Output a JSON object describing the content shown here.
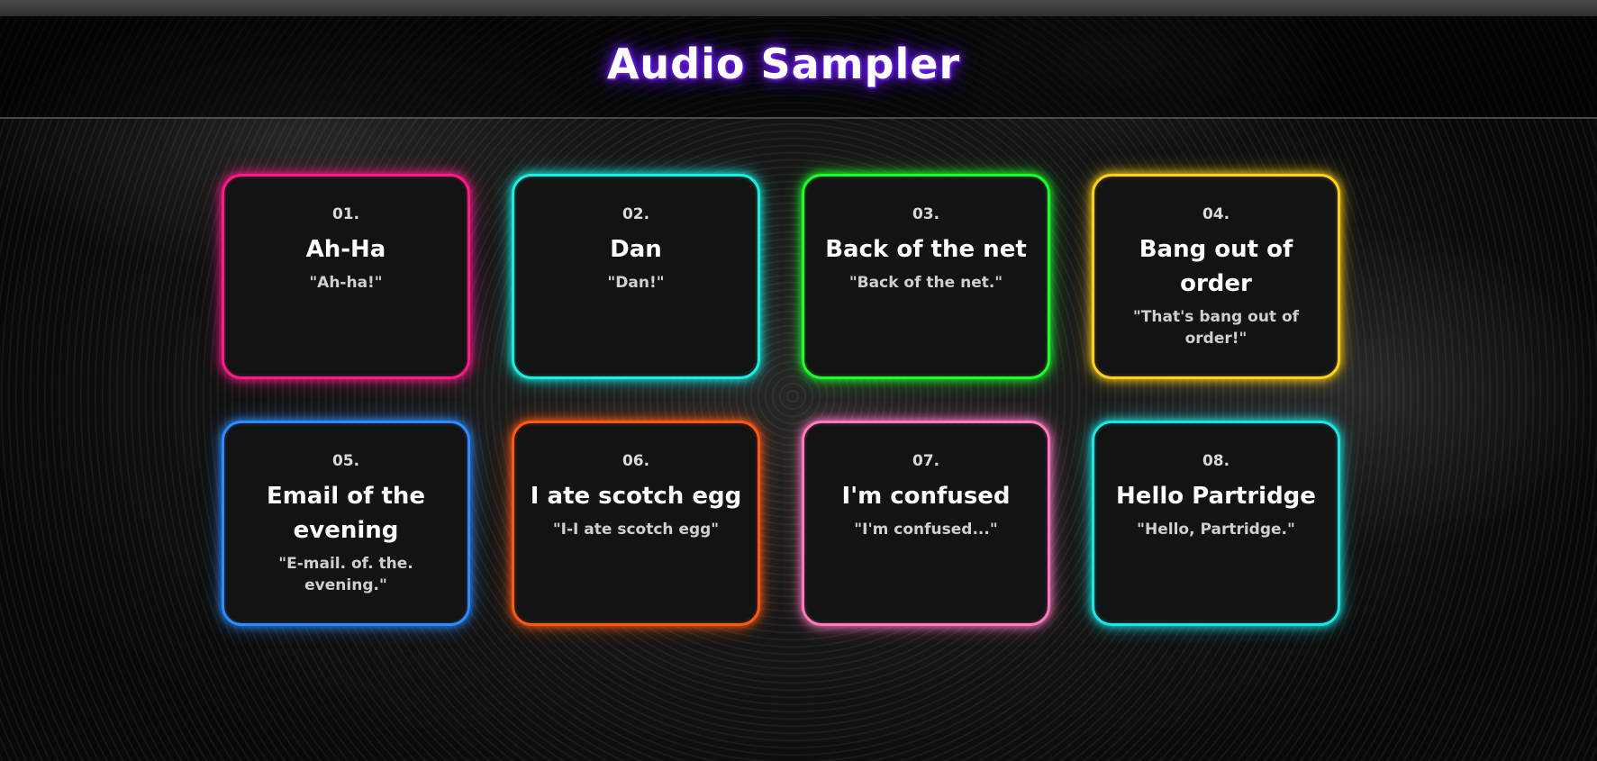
{
  "header": {
    "title": "Audio Sampler",
    "accent": "#6a1fe8"
  },
  "pads": [
    {
      "number": "01.",
      "name": "Ah-Ha",
      "quote": "\"Ah-ha!\"",
      "color": "#ff1a8c"
    },
    {
      "number": "02.",
      "name": "Dan",
      "quote": "\"Dan!\"",
      "color": "#19f0e4"
    },
    {
      "number": "03.",
      "name": "Back of the net",
      "quote": "\"Back of the net.\"",
      "color": "#1cff2a"
    },
    {
      "number": "04.",
      "name": "Bang out of order",
      "quote": "\"That's bang out of order!\"",
      "color": "#ffd21a"
    },
    {
      "number": "05.",
      "name": "Email of the evening",
      "quote": "\"E-mail. of. the. evening.\"",
      "color": "#2b8cff"
    },
    {
      "number": "06.",
      "name": "I ate scotch egg",
      "quote": "\"I-I ate scotch egg\"",
      "color": "#ff5a14"
    },
    {
      "number": "07.",
      "name": "I'm confused",
      "quote": "\"I'm confused...\"",
      "color": "#ff7ac0"
    },
    {
      "number": "08.",
      "name": "Hello Partridge",
      "quote": "\"Hello, Partridge.\"",
      "color": "#1ae6e6"
    }
  ]
}
